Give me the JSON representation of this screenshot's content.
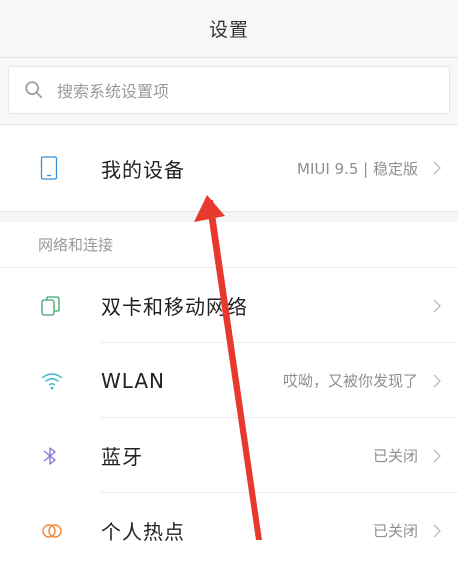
{
  "header": {
    "title": "设置"
  },
  "search": {
    "placeholder": "搜索系统设置项"
  },
  "device": {
    "label": "我的设备",
    "value": "MIUI 9.5 | 稳定版"
  },
  "network_section": {
    "header": "网络和连接",
    "items": [
      {
        "label": "双卡和移动网络",
        "value": "",
        "icon": "dual-sim-icon"
      },
      {
        "label": "WLAN",
        "value": "哎呦，又被你发现了",
        "icon": "wifi-icon"
      },
      {
        "label": "蓝牙",
        "value": "已关闭",
        "icon": "bluetooth-icon"
      },
      {
        "label": "个人热点",
        "value": "已关闭",
        "icon": "hotspot-icon"
      }
    ]
  },
  "colors": {
    "annotation_arrow": "#e8392f",
    "wifi": "#3fb6c9",
    "bluetooth": "#8a6fd6",
    "hotspot": "#f0873a",
    "sim": "#3aa56a",
    "device": "#3a8fd6"
  }
}
